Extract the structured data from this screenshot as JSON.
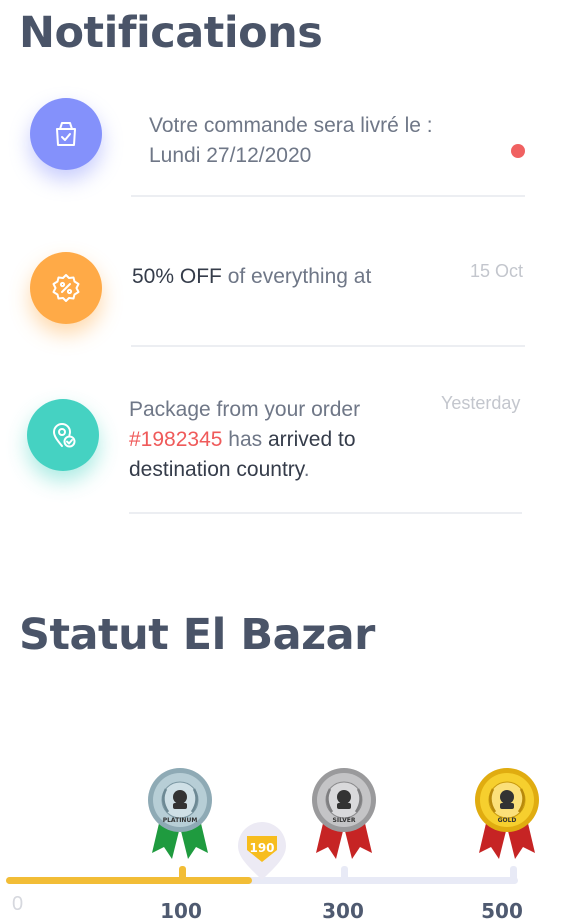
{
  "notifications_title": "Notifications",
  "notifications": [
    {
      "icon": "package-icon",
      "line1": "Votre commande sera livré le :",
      "line2": "Lundi 27/12/2020",
      "unread": true,
      "color": "#8491fb"
    },
    {
      "icon": "discount-icon",
      "highlight": "50% OFF",
      "text": " of everything at",
      "time": "15 Oct",
      "color": "#ffaa47"
    },
    {
      "icon": "location-check-icon",
      "text_a": "Package from your order",
      "order_number": "#1982345",
      "text_b": " has ",
      "text_c": "arrived to",
      "text_d": "destination country",
      "text_e": ".",
      "time": "Yesterday",
      "color": "#45d2c2"
    }
  ],
  "status_title": "Statut El Bazar",
  "status": {
    "current_points": "190",
    "progress_fraction": 0.48,
    "track_color": "#f2bd36",
    "labels": [
      "0",
      "100",
      "300",
      "500"
    ],
    "medals": [
      {
        "name": "PLATINUM",
        "color": "#9fb8c2",
        "ribbon": "#1f9b3f"
      },
      {
        "name": "SILVER",
        "color": "#a9a9ab",
        "ribbon": "#c62424"
      },
      {
        "name": "GOLD",
        "color": "#f3c51f",
        "ribbon": "#c62424"
      }
    ]
  }
}
